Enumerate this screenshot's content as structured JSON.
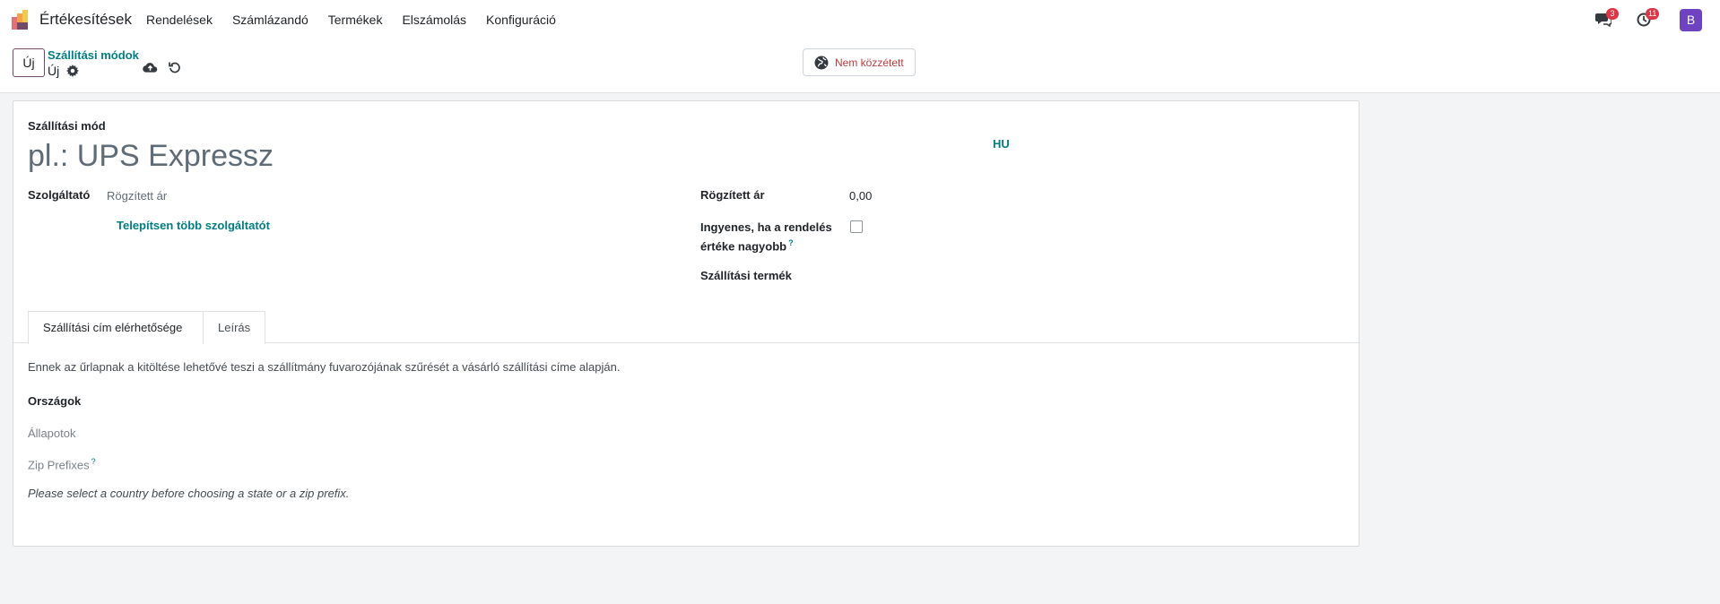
{
  "app": {
    "name": "Értékesítések",
    "menu": [
      "Rendelések",
      "Számlázandó",
      "Termékek",
      "Elszámolás",
      "Konfiguráció"
    ]
  },
  "nav_right": {
    "messages_count": "3",
    "activities_count": "11",
    "avatar_letter": "B"
  },
  "control": {
    "new_label": "Új",
    "breadcrumb": "Szállítási módok",
    "record_name": "Új",
    "publish_label": "Nem közzétett"
  },
  "form": {
    "name_label": "Szállítási mód",
    "name_placeholder": "pl.: UPS Expressz",
    "lang": "HU",
    "provider_label": "Szolgáltató",
    "provider_value": "Rögzített ár",
    "install_more": "Telepítsen több szolgáltatót",
    "fixed_price_label": "Rögzített ár",
    "fixed_price_value": "0,00",
    "free_if_label_line1": "Ingyenes, ha a rendelés",
    "free_if_label_line2": "értéke nagyobb",
    "free_if_tooltip": "?",
    "delivery_product_label": "Szállítási termék"
  },
  "tabs": [
    {
      "label": "Szállítási cím elérhetősége",
      "active": true
    },
    {
      "label": "Leírás",
      "active": false
    }
  ],
  "availability": {
    "info": "Ennek az űrlapnak a kitöltése lehetővé teszi a szállítmány fuvarozójának szűrését a vásárló szállítási címe alapján.",
    "countries_label": "Országok",
    "states_label": "Állapotok",
    "zip_label": "Zip Prefixes",
    "zip_tooltip": "?",
    "hint": "Please select a country before choosing a state or a zip prefix."
  },
  "colors": {
    "brand": "#714b67",
    "link": "#017e84",
    "badge": "#dc3545",
    "avatar": "#6f42c1",
    "unpublished": "#c03c3c"
  }
}
